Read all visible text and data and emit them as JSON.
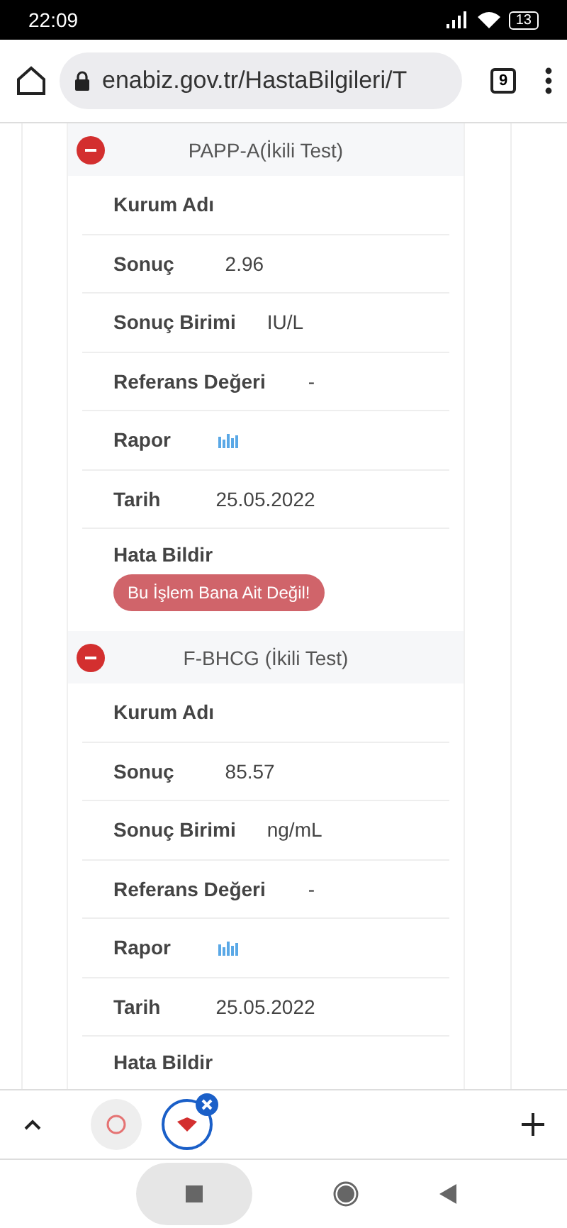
{
  "status_bar": {
    "time": "22:09",
    "battery": "13"
  },
  "browser": {
    "url": "enabiz.gov.tr/HastaBilgileri/T",
    "tab_count": "9"
  },
  "sections": [
    {
      "title": "PAPP-A(İkili Test)",
      "expanded": true,
      "rows": [
        {
          "label": "Kurum Adı",
          "value": "",
          "kind": "text"
        },
        {
          "label": "Sonuç",
          "value": "2.96",
          "kind": "text"
        },
        {
          "label": "Sonuç Birimi",
          "value": "IU/L",
          "kind": "text"
        },
        {
          "label": "Referans Değeri",
          "value": "-",
          "kind": "text"
        },
        {
          "label": "Rapor",
          "kind": "chart"
        },
        {
          "label": "Tarih",
          "value": "25.05.2022",
          "kind": "text"
        }
      ],
      "report_label": "Hata Bildir",
      "report_button": "Bu İşlem Bana Ait Değil!"
    },
    {
      "title": "F-BHCG (İkili Test)",
      "expanded": true,
      "rows": [
        {
          "label": "Kurum Adı",
          "value": "",
          "kind": "text"
        },
        {
          "label": "Sonuç",
          "value": "85.57",
          "kind": "text"
        },
        {
          "label": "Sonuç Birimi",
          "value": "ng/mL",
          "kind": "text"
        },
        {
          "label": "Referans Değeri",
          "value": "-",
          "kind": "text"
        },
        {
          "label": "Rapor",
          "kind": "chart"
        },
        {
          "label": "Tarih",
          "value": "25.05.2022",
          "kind": "text"
        }
      ],
      "report_label": "Hata Bildir"
    }
  ],
  "tab_groups": [
    {
      "selected": false
    },
    {
      "selected": true
    }
  ]
}
